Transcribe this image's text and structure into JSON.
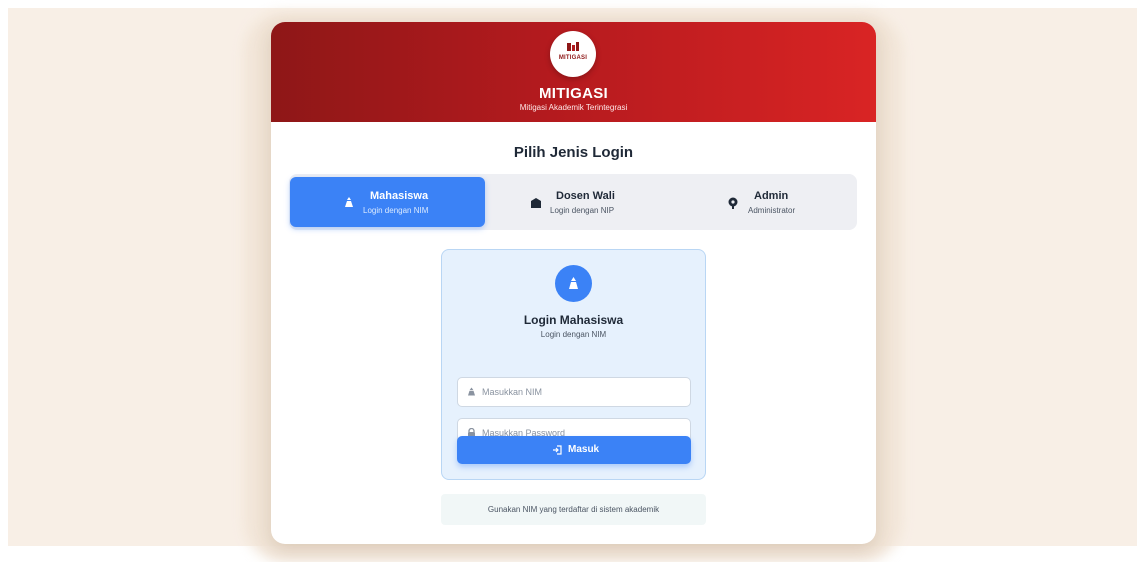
{
  "brand": {
    "logo_text": "MITIGASI",
    "title": "MITIGASI",
    "subtitle": "Mitigasi Akademik Terintegrasi"
  },
  "login_type": {
    "heading": "Pilih Jenis Login",
    "tabs": [
      {
        "label": "Mahasiswa",
        "sub": "Login dengan NIM",
        "icon": "student-cap-icon",
        "active": true
      },
      {
        "label": "Dosen Wali",
        "sub": "Login dengan NIP",
        "icon": "building-icon",
        "active": false
      },
      {
        "label": "Admin",
        "sub": "Administrator",
        "icon": "admin-icon",
        "active": false
      }
    ]
  },
  "form": {
    "title": "Login Mahasiswa",
    "subtitle": "Login dengan NIM",
    "nim_placeholder": "Masukkan NIM",
    "nim_value": "",
    "password_placeholder": "Masukkan Password",
    "password_value": "",
    "submit_label": "Masuk"
  },
  "hint": "Gunakan NIM yang terdaftar di sistem akademik",
  "colors": {
    "header_start": "#8e1717",
    "header_end": "#d92424",
    "accent": "#3b82f6",
    "page_bg": "#f8efe6"
  }
}
